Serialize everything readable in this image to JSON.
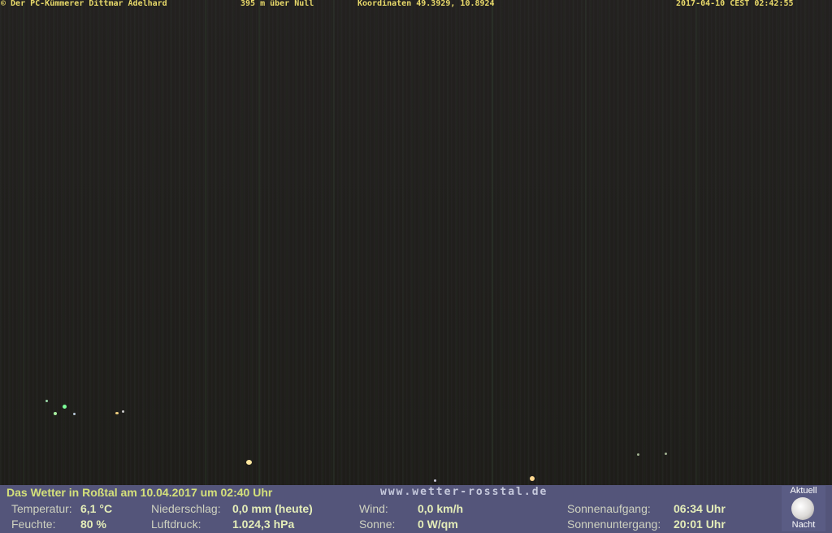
{
  "overlay": {
    "copyright": "© Der PC-Kümmerer Dittmar Adelhard",
    "altitude": "395 m über Null",
    "coordinates": "Koordinaten 49.3929, 10.8924",
    "timestamp": "2017-04-10 CEST 02:42:55"
  },
  "weather": {
    "title": "Das Wetter in Roßtal am 10.04.2017 um 02:40 Uhr",
    "website": "www.wetter-rosstal.de",
    "temperature_label": "Temperatur:",
    "temperature_value": "6,1 °C",
    "humidity_label": "Feuchte:",
    "humidity_value": "80 %",
    "precipitation_label": "Niederschlag:",
    "precipitation_value": "0,0 mm (heute)",
    "pressure_label": "Luftdruck:",
    "pressure_value": "1.024,3 hPa",
    "wind_label": "Wind:",
    "wind_value": "0,0 km/h",
    "sun_label": "Sonne:",
    "sun_value": "0 W/qm",
    "sunrise_label": "Sonnenaufgang:",
    "sunrise_value": "06:34 Uhr",
    "sunset_label": "Sonnenuntergang:",
    "sunset_value": "20:01 Uhr"
  },
  "moon": {
    "top_label": "Aktuell",
    "bottom_label": "Nacht"
  },
  "colors": {
    "overlay_text": "#e8d96a",
    "info_background": "#54557a",
    "title_text": "#d4e07a"
  }
}
